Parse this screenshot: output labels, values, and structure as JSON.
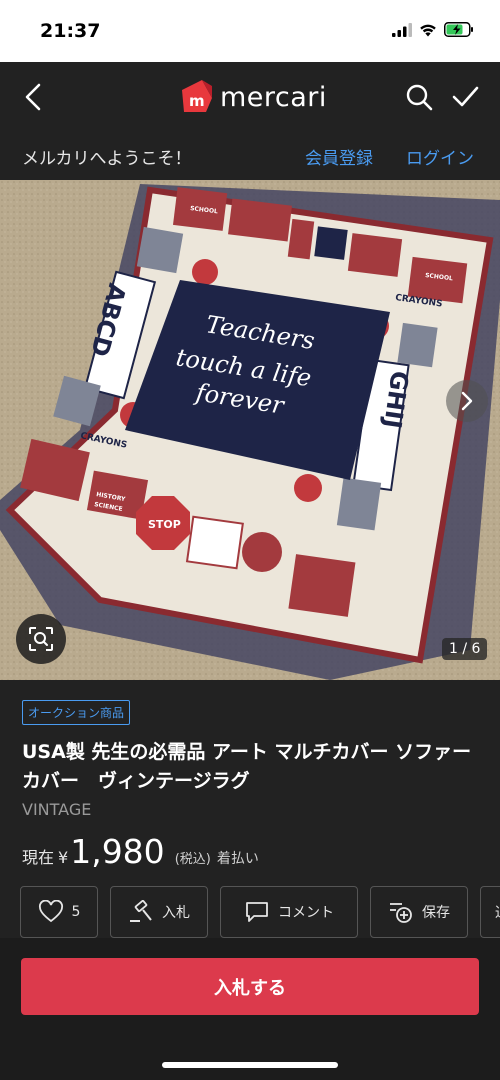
{
  "status": {
    "time": "21:37",
    "icons": [
      "signal-icon",
      "wifi-icon",
      "battery-charging-icon"
    ]
  },
  "nav": {
    "logo_text": "mercari",
    "icons": [
      "back-chevron-icon",
      "search-icon",
      "checkmark-icon"
    ]
  },
  "welcome": {
    "text": "メルカリへようこそ！",
    "register": "会員登録",
    "login": "ログイン"
  },
  "gallery": {
    "pager": "1 / 6",
    "rug": {
      "motto_lines": [
        "Teachers",
        "touch a life",
        "forever"
      ],
      "letters_left": "ABCD",
      "letters_right": "GHIJ",
      "labels": [
        "CRAYONS",
        "CRAYONS",
        "STOP",
        "SCHOOL",
        "SCHOOL",
        "HISTORY",
        "SCIENCE"
      ]
    }
  },
  "item": {
    "badge": "オークション商品",
    "title": "USA製 先生の必需品 アート マルチカバー ソファーカバー　ヴィンテージラグ",
    "brand": "VINTAGE",
    "price_prefix": "現在",
    "currency": "¥",
    "price": "1,980",
    "tax": "(税込)",
    "shipping": "着払い"
  },
  "actions": {
    "like_count": "5",
    "bid": "入札",
    "comment": "コメント",
    "save": "保存",
    "share": "通"
  },
  "bottom": {
    "bid_button": "入札する"
  },
  "colors": {
    "accent": "#dc3a4c",
    "link": "#4a9bf0",
    "background": "#222222",
    "logo_red": "#e8383d"
  }
}
